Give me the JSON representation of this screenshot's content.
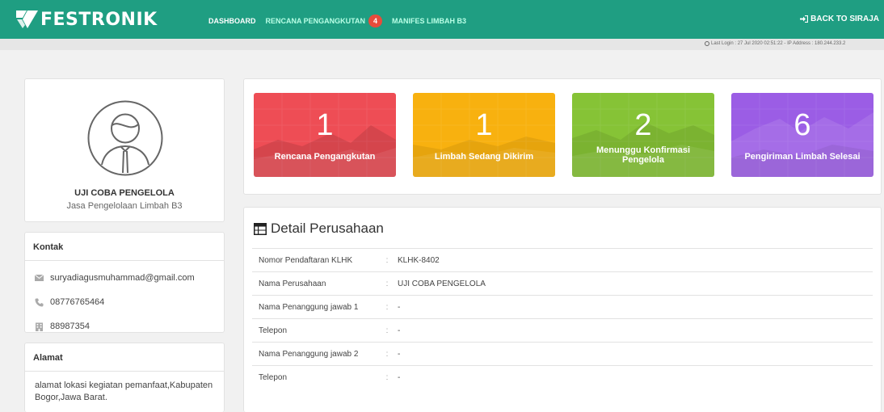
{
  "brand": {
    "name": "FESTRONIK"
  },
  "nav": {
    "items": [
      {
        "label": "DASHBOARD",
        "active": true
      },
      {
        "label": "RENCANA PENGANGKUTAN",
        "badge": "4"
      },
      {
        "label": "MANIFES LIMBAH B3"
      }
    ],
    "back": "BACK TO SIRAJA"
  },
  "info": {
    "last_login": "Last Login : 27 Jul 2020 02:51:22 - IP Address : 180.244.233.2"
  },
  "profile": {
    "name": "UJI COBA PENGELOLA",
    "role": "Jasa Pengelolaan Limbah B3"
  },
  "kontak": {
    "title": "Kontak",
    "email": "suryadiagusmuhammad@gmail.com",
    "phone": "08776765464",
    "fax": "88987354"
  },
  "alamat": {
    "title": "Alamat",
    "text": "alamat lokasi kegiatan pemanfaat,Kabupaten Bogor,Jawa Barat."
  },
  "stats": [
    {
      "value": "1",
      "label": "Rencana Pengangkutan",
      "color": "#ee4d55"
    },
    {
      "value": "1",
      "label": "Limbah Sedang Dikirim",
      "color": "#f8b10f"
    },
    {
      "value": "2",
      "label": "Menunggu Konfirmasi Pengelola",
      "label_line1": "Menunggu Konfirmasi",
      "label_line2": "Pengelola",
      "color": "#86c336"
    },
    {
      "value": "6",
      "label": "Pengiriman Limbah Selesai",
      "color": "#9b5de5"
    }
  ],
  "detail": {
    "title": "Detail Perusahaan",
    "rows": [
      {
        "label": "Nomor Pendaftaran KLHK",
        "value": "KLHK-8402"
      },
      {
        "label": "Nama Perusahaan",
        "value": "UJI COBA PENGELOLA"
      },
      {
        "label": "Nama Penanggung jawab 1",
        "value": "-"
      },
      {
        "label": "Telepon",
        "value": "-"
      },
      {
        "label": "Nama Penanggung jawab 2",
        "value": "-"
      },
      {
        "label": "Telepon",
        "value": "-"
      }
    ]
  },
  "colors": {
    "header": "#1f9e82",
    "badge": "#e74c3c"
  }
}
